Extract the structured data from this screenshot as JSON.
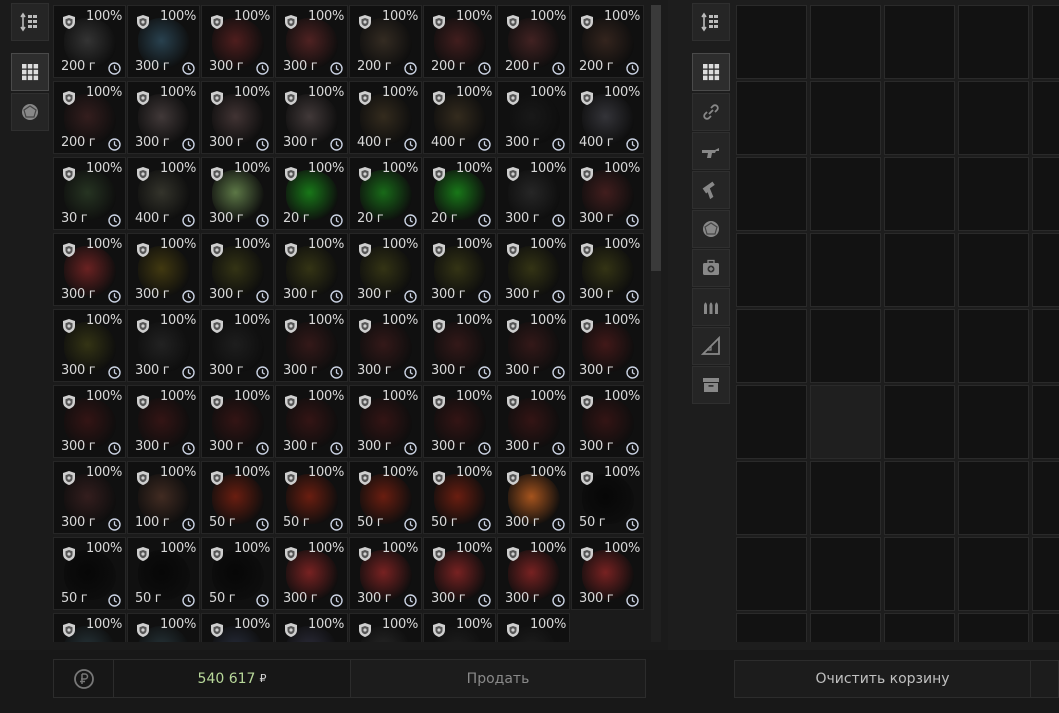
{
  "left_grid": {
    "columns": 8,
    "rows": [
      [
        "200 г",
        "300 г",
        "300 г",
        "300 г",
        "200 г",
        "200 г",
        "200 г",
        "200 г"
      ],
      [
        "200 г",
        "300 г",
        "300 г",
        "300 г",
        "400 г",
        "400 г",
        "300 г",
        "400 г"
      ],
      [
        "30 г",
        "400 г",
        "300 г",
        "20 г",
        "20 г",
        "20 г",
        "300 г",
        "300 г"
      ],
      [
        "300 г",
        "300 г",
        "300 г",
        "300 г",
        "300 г",
        "300 г",
        "300 г",
        "300 г"
      ],
      [
        "300 г",
        "300 г",
        "300 г",
        "300 г",
        "300 г",
        "300 г",
        "300 г",
        "300 г"
      ],
      [
        "300 г",
        "300 г",
        "300 г",
        "300 г",
        "300 г",
        "300 г",
        "300 г",
        "300 г"
      ],
      [
        "300 г",
        "100 г",
        "50 г",
        "50 г",
        "50 г",
        "50 г",
        "300 г",
        "50 г"
      ],
      [
        "50 г",
        "50 г",
        "50 г",
        "300 г",
        "300 г",
        "300 г",
        "300 г",
        "300 г"
      ],
      [
        "",
        "",
        "",
        "",
        "",
        "",
        "",
        null
      ]
    ],
    "durability": "100%",
    "item_colors": [
      [
        "#3a3a3a",
        "#2d4a5a",
        "#5a2020",
        "#5a2525",
        "#3a3025",
        "#4a2020",
        "#4a2525",
        "#3a2820"
      ],
      [
        "#3a2020",
        "#4a4040",
        "#4a3a3a",
        "#4a4040",
        "#3a3020",
        "#3a3020",
        "#1a1a1a",
        "#3a3a40"
      ],
      [
        "#2a3a25",
        "#3a3a30",
        "#6a8a50",
        "#1a8a1a",
        "#1a7a1a",
        "#1a8a1a",
        "#2a2a2a",
        "#4a2020"
      ],
      [
        "#7a2525",
        "#4a4010",
        "#3a3a15",
        "#3a3a15",
        "#3a3a15",
        "#3a3a15",
        "#3a3a15",
        "#3a3a15"
      ],
      [
        "#3a3a15",
        "#252525",
        "#202020",
        "#3a1a1a",
        "#3a1a1a",
        "#3a1a1a",
        "#3a1a1a",
        "#4a1a1a"
      ],
      [
        "#3a1515",
        "#3a1515",
        "#3a1515",
        "#3a1515",
        "#3a1515",
        "#3a1515",
        "#3a1515",
        "#3a1515"
      ],
      [
        "#3a2020",
        "#4a3025",
        "#7a2010",
        "#7a2010",
        "#7a2010",
        "#7a2010",
        "#c06020",
        "#050505"
      ],
      [
        "#050505",
        "#050505",
        "#050505",
        "#8a2525",
        "#8a2525",
        "#8a2525",
        "#8a2525",
        "#8a2525"
      ],
      [
        "#2a3a40",
        "#2a3a40",
        "#2a3040",
        "#303040",
        "#2a2a2a",
        "#202020",
        "#202020",
        ""
      ]
    ]
  },
  "footer": {
    "balance": "540 617",
    "currency": "₽",
    "sell_label": "Продать",
    "clear_label": "Очистить корзину"
  },
  "left_toolbar": {
    "items": [
      "sort-icon",
      "grid-view-icon",
      "barter-items-icon"
    ]
  },
  "right_toolbar": {
    "items": [
      "sort-icon",
      "grid-view-icon",
      "link-icon",
      "rifle-icon",
      "pistol-icon",
      "barter-items-icon",
      "medkit-icon",
      "ammo-icon",
      "ruler-icon",
      "box-icon"
    ]
  }
}
